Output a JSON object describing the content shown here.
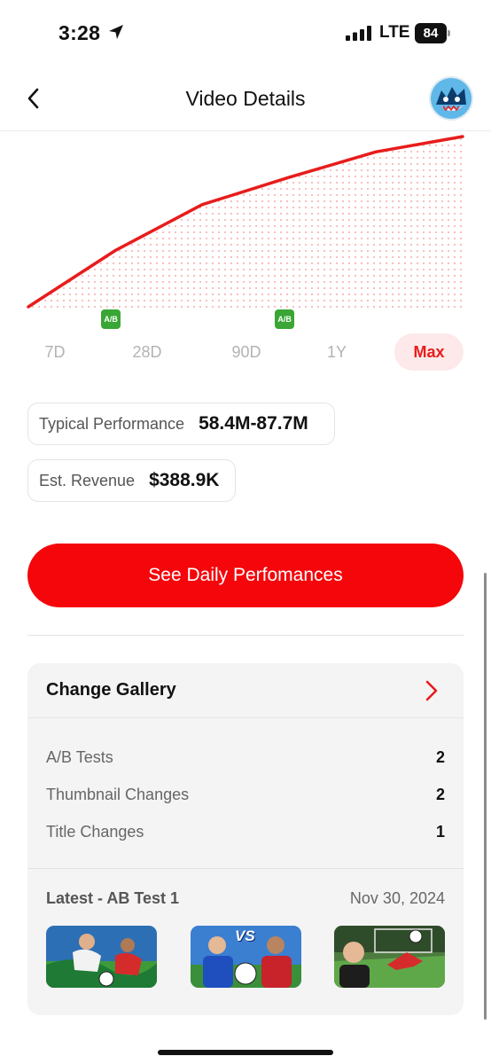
{
  "status_bar": {
    "time": "3:28",
    "network": "LTE",
    "battery": "84"
  },
  "nav": {
    "title": "Video Details"
  },
  "chart_data": {
    "type": "area",
    "title": "",
    "xlabel": "",
    "ylabel": "",
    "period": "Max",
    "series": [
      {
        "values": [
          0.0,
          0.33,
          0.6,
          0.76,
          0.91,
          1.0
        ]
      }
    ],
    "markers": [
      {
        "label": "A/B",
        "position": 0.19
      },
      {
        "label": "A/B",
        "position": 0.59
      }
    ],
    "color": "#e81c1c",
    "grid": false
  },
  "period_tabs": [
    {
      "label": "7D",
      "active": false
    },
    {
      "label": "28D",
      "active": false
    },
    {
      "label": "90D",
      "active": false
    },
    {
      "label": "1Y",
      "active": false
    },
    {
      "label": "Max",
      "active": true
    }
  ],
  "stats": {
    "typical_performance": {
      "label": "Typical Performance",
      "value": "58.4M-87.7M"
    },
    "est_revenue": {
      "label": "Est. Revenue",
      "value": "$388.9K"
    }
  },
  "cta": {
    "label": "See Daily Perfomances"
  },
  "change_gallery": {
    "title": "Change Gallery",
    "rows": [
      {
        "label": "A/B Tests",
        "value": "2"
      },
      {
        "label": "Thumbnail Changes",
        "value": "2"
      },
      {
        "label": "Title Changes",
        "value": "1"
      }
    ],
    "latest_label": "Latest - AB Test 1",
    "latest_date": "Nov 30, 2024",
    "thumbnail_badge": "VS"
  },
  "colors": {
    "accent": "#f4060b",
    "ab_badge": "#3aa635"
  }
}
